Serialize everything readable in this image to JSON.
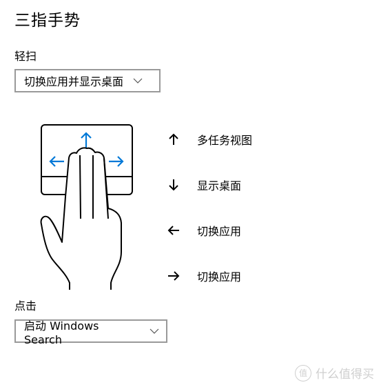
{
  "title": "三指手势",
  "swipe": {
    "label": "轻扫",
    "selected": "切换应用并显示桌面"
  },
  "gestures": [
    {
      "arrow": "arrow-up-icon",
      "text": "多任务视图"
    },
    {
      "arrow": "arrow-down-icon",
      "text": "显示桌面"
    },
    {
      "arrow": "arrow-left-icon",
      "text": "切换应用"
    },
    {
      "arrow": "arrow-right-icon",
      "text": "切换应用"
    }
  ],
  "tap": {
    "label": "点击",
    "selected": "启动 Windows Search"
  },
  "illustration": {
    "accent_color": "#0078d7"
  },
  "watermark": {
    "badge": "值",
    "text": "什么值得买"
  }
}
